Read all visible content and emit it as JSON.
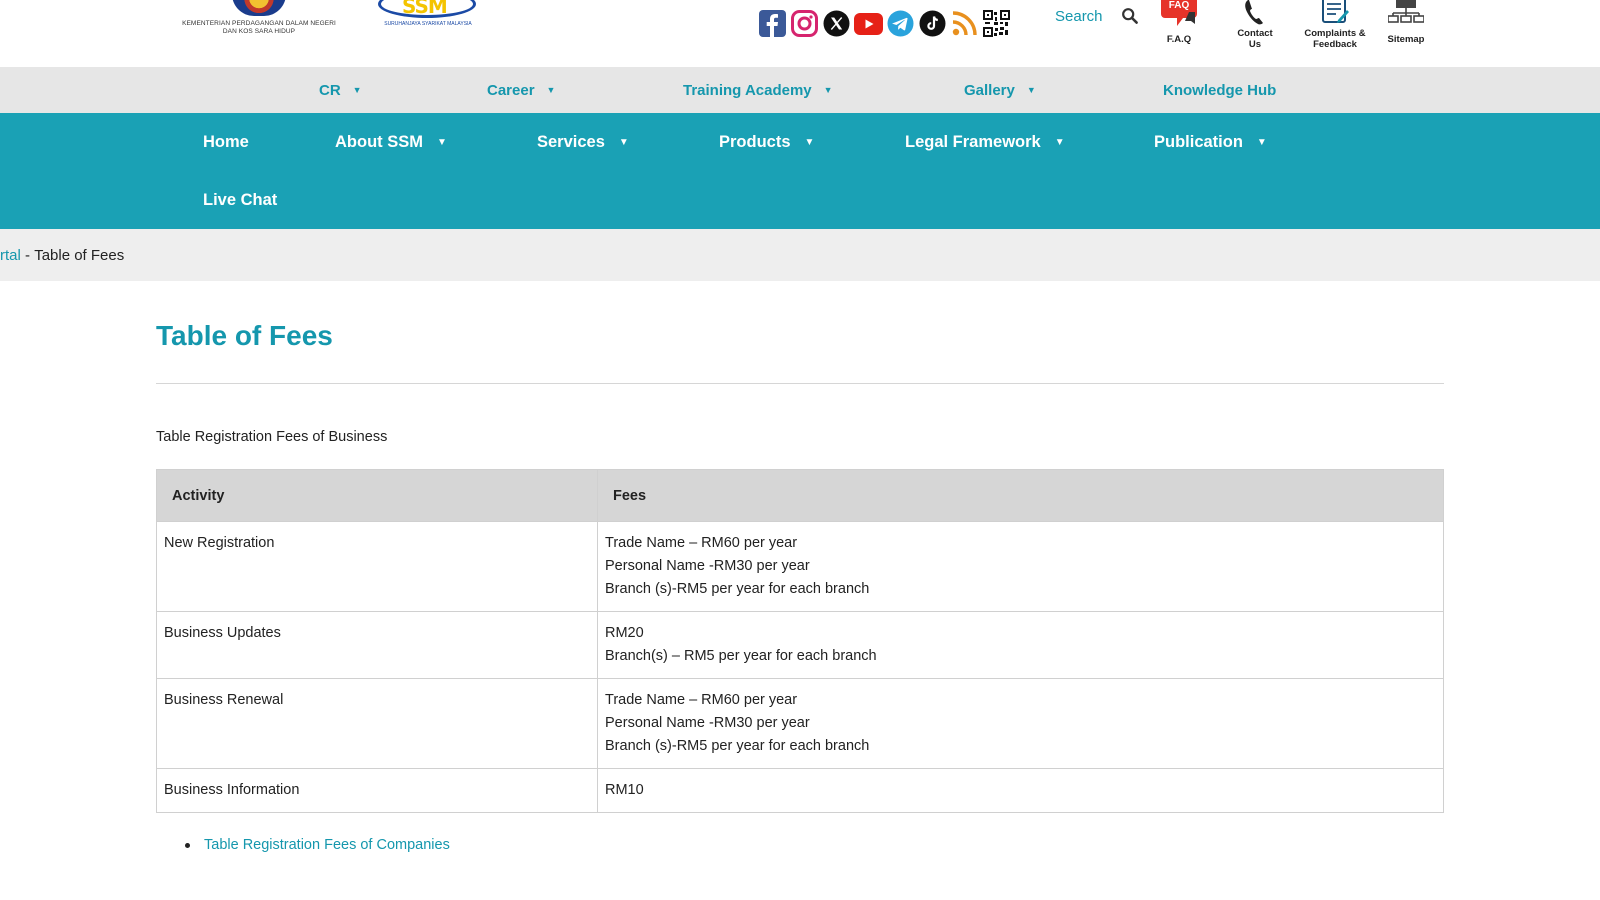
{
  "header": {
    "ministry_text_line1": "KEMENTERIAN PERDAGANGAN DALAM NEGERI",
    "ministry_text_line2": "DAN KOS SARA HIDUP",
    "ssm_logo_text": "SSM",
    "ssm_caption": "SURUHANJAYA SYARIKAT MALAYSIA",
    "social_icons": [
      "facebook-icon",
      "instagram-icon",
      "x-icon",
      "youtube-icon",
      "telegram-icon",
      "tiktok-icon",
      "rss-icon",
      "qr-code-icon"
    ],
    "search_label": "Search",
    "quick_links": {
      "faq_badge": "FAQ",
      "faq": "F.A.Q",
      "contact_line1": "Contact",
      "contact_line2": "Us",
      "complaints_line1": "Complaints &",
      "complaints_line2": "Feedback",
      "sitemap": "Sitemap"
    }
  },
  "subnav": {
    "items": [
      {
        "label": "CR",
        "has_dropdown": true
      },
      {
        "label": "Career",
        "has_dropdown": true
      },
      {
        "label": "Training Academy",
        "has_dropdown": true
      },
      {
        "label": "Gallery",
        "has_dropdown": true
      },
      {
        "label": "Knowledge Hub",
        "has_dropdown": false
      }
    ]
  },
  "mainnav": {
    "items": [
      {
        "label": "Home",
        "has_dropdown": false
      },
      {
        "label": "About SSM",
        "has_dropdown": true
      },
      {
        "label": "Services",
        "has_dropdown": true
      },
      {
        "label": "Products",
        "has_dropdown": true
      },
      {
        "label": "Legal Framework",
        "has_dropdown": true
      },
      {
        "label": "Publication",
        "has_dropdown": true
      },
      {
        "label": "Live Chat",
        "has_dropdown": false
      }
    ]
  },
  "breadcrumb": {
    "parent": "rtal",
    "separator": " - ",
    "current": "Table of Fees"
  },
  "content": {
    "title": "Table of Fees",
    "intro": "Table Registration Fees of Business",
    "table": {
      "headers": [
        "Activity",
        "Fees"
      ],
      "rows": [
        {
          "activity": "New Registration",
          "fees": [
            "Trade Name – RM60 per year",
            "Personal Name -RM30 per year",
            "Branch (s)-RM5 per year for each branch"
          ]
        },
        {
          "activity": "Business Updates",
          "fees": [
            "RM20",
            "Branch(s) – RM5 per year for each branch"
          ]
        },
        {
          "activity": "Business Renewal",
          "fees": [
            "Trade Name – RM60 per year",
            "Personal Name -RM30 per year",
            "Branch (s)-RM5 per year for each branch"
          ]
        },
        {
          "activity": "Business Information",
          "fees": [
            "RM10"
          ]
        }
      ]
    },
    "related_link": "Table Registration Fees of Companies"
  },
  "colors": {
    "accent": "#1597ad",
    "nav_bg": "#1aa1b5",
    "subnav_bg": "#e6e6e6",
    "breadcrumb_bg": "#eeeeee",
    "table_header_bg": "#d6d6d6"
  }
}
